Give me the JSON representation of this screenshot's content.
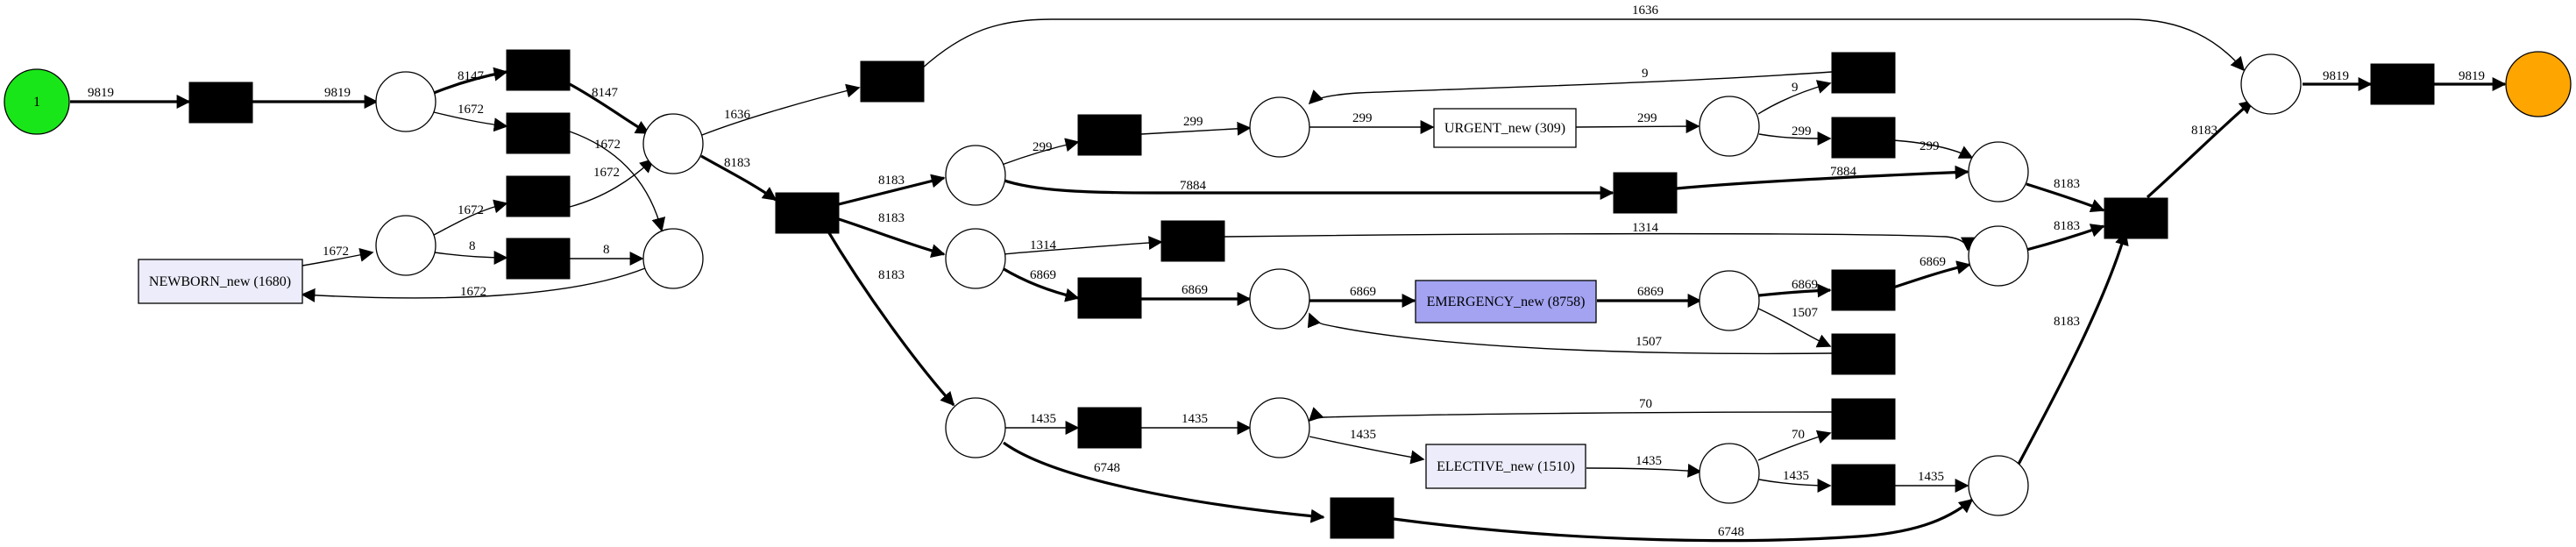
{
  "colors": {
    "start_place": "#19e619",
    "end_place": "#ffa500",
    "activity_light": "#ececfa",
    "activity_emergency": "#a3a3f2",
    "activity_urgent": "#ffffff",
    "transition": "#000000"
  },
  "start_place": {
    "label": "1"
  },
  "activities": {
    "newborn": "NEWBORN_new (1680)",
    "urgent": "URGENT_new (309)",
    "emergency": "EMERGENCY_new (8758)",
    "elective": "ELECTIVE_new (1510)"
  },
  "arcs": {
    "a1": "9819",
    "a2": "9819",
    "a3": "8147",
    "a4": "1672",
    "a5": "8147",
    "a6": "1672",
    "a7": "1672",
    "a8": "1672",
    "a9": "1672",
    "a10": "8",
    "a11": "8",
    "a12": "1672",
    "a13": "1636",
    "a14": "1636",
    "a15": "8183",
    "a16": "8183",
    "a17": "8183",
    "a18": "8183",
    "a19": "299",
    "a20": "299",
    "a21": "299",
    "a22": "299",
    "a23": "9",
    "a24": "299",
    "a25": "9",
    "a26": "299",
    "a27": "7884",
    "a28": "7884",
    "a29": "8183",
    "a30": "1314",
    "a31": "1314",
    "a32": "8183",
    "a33": "6869",
    "a34": "6869",
    "a35": "6869",
    "a36": "6869",
    "a37": "6869",
    "a38": "6869",
    "a39": "1507",
    "a40": "1507",
    "a41": "1435",
    "a42": "1435",
    "a43": "1435",
    "a44": "1435",
    "a45": "70",
    "a46": "70",
    "a47": "1435",
    "a48": "1435",
    "a49": "6748",
    "a50": "6748",
    "a51": "8183",
    "a52": "8183",
    "a53": "9819",
    "a54": "9819"
  }
}
